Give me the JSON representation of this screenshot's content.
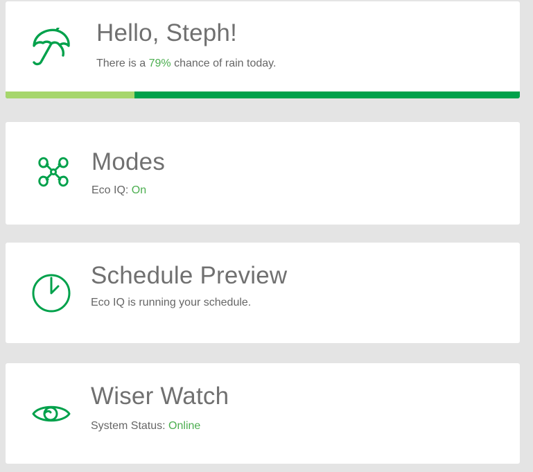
{
  "greeting": {
    "title": "Hello, Steph!",
    "rain_prefix": "There is a ",
    "rain_value": "79%",
    "rain_suffix": " chance of rain today.",
    "rain_chance_fraction": 0.25,
    "icon": "umbrella-icon"
  },
  "modes": {
    "title": "Modes",
    "status_label": "Eco IQ: ",
    "status_value": "On",
    "icon": "fan-icon"
  },
  "schedule": {
    "title": "Schedule Preview",
    "subtitle": "Eco IQ is running your schedule.",
    "icon": "clock-icon"
  },
  "watch": {
    "title": "Wiser Watch",
    "status_label": "System Status: ",
    "status_value": "Online",
    "icon": "eye-icon"
  },
  "colors": {
    "background": "#e4e4e4",
    "card": "#ffffff",
    "accent_green": "#00a14b",
    "light_green": "#a6d66c",
    "status_green": "#4bae4f",
    "title_gray": "#707070"
  }
}
